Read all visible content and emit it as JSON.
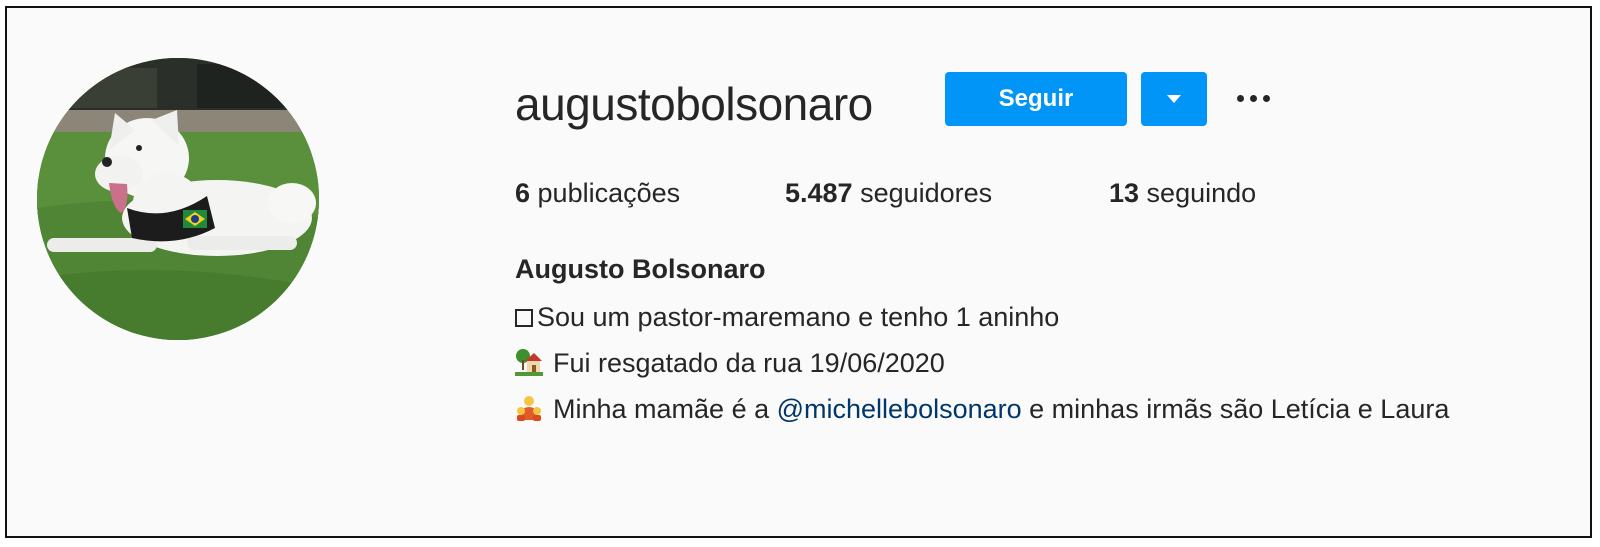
{
  "profile": {
    "username": "augustobolsonaro",
    "full_name": "Augusto Bolsonaro",
    "avatar_icon": "white-dog-on-grass-avatar"
  },
  "actions": {
    "follow_label": "Seguir",
    "dropdown_icon": "caret-down-icon",
    "more_icon": "ellipsis-icon"
  },
  "stats": {
    "posts_count": "6",
    "posts_label": " publicações",
    "followers_count": "5.487",
    "followers_label": " seguidores",
    "following_count": "13",
    "following_label": " seguindo"
  },
  "bio": {
    "line1": "Sou um pastor-maremano e tenho 1 aninho",
    "line1_icon": "box-glyph",
    "line2": "Fui resgatado da rua 19/06/2020",
    "line2_icon": "house-with-garden-icon",
    "line3_before": "Minha mamãe é a ",
    "line3_mention": "@michellebolsonaro",
    "line3_after": " e minhas irmãs são Letícia e Laura",
    "line3_icon": "family-emoji-icon"
  },
  "colors": {
    "accent": "#0095f6",
    "mention": "#00376b",
    "text": "#262626",
    "background": "#fafafa"
  }
}
